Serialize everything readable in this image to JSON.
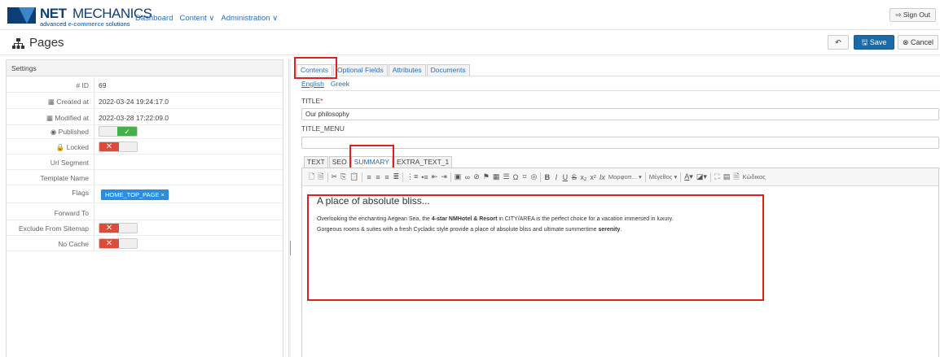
{
  "brand": {
    "name_bold": "NET",
    "name_rest": "MECHANICS",
    "tagline_pre": "advanced ",
    "tagline_bold": "e-commerce",
    "tagline_post": " solutions"
  },
  "nav": {
    "dashboard": "Dashboard",
    "content": "Content ∨",
    "administration": "Administration ∨",
    "sign_out": "⇨ Sign Out"
  },
  "header": {
    "title": "Pages",
    "back": "↶",
    "save": "🖫 Save",
    "cancel": "⊗ Cancel"
  },
  "settings": {
    "title": "Settings",
    "id_label": "# ID",
    "id_value": "69",
    "created_label": "▦ Created at",
    "created_value": "2022-03-24 19:24:17.0",
    "modified_label": "▦ Modified at",
    "modified_value": "2022-03-28 17:22:09.0",
    "published_label": "◉ Published",
    "published": true,
    "locked_label": "🔒 Locked",
    "locked": false,
    "url_segment_label": "Url Segment",
    "template_name_label": "Template Name",
    "flags_label": "Flags",
    "flag_value": "HOME_TOP_PAGE ×",
    "forward_to_label": "Forward To",
    "exclude_sitemap_label": "Exclude From Sitemap",
    "exclude_sitemap": false,
    "no_cache_label": "No Cache",
    "no_cache": false,
    "toggle_on": "✓",
    "toggle_off": "✕"
  },
  "tabs": [
    "Contents",
    "Optional Fields",
    "Attributes",
    "Documents"
  ],
  "languages": [
    "English",
    "Greek"
  ],
  "fields": {
    "title_label": "TITLE",
    "title_required": "*",
    "title_value": "Our philosophy",
    "title_menu_label": "TITLE_MENU",
    "title_menu_value": ""
  },
  "editor_tabs": [
    "TEXT",
    "SEO",
    "SUMMARY",
    "EXTRA_TEXT_1"
  ],
  "toolbar": {
    "format_combo": "Μορφοπ...  ▾",
    "size_combo": "Μέγεθος   ▾",
    "source_label": "Κώδικας"
  },
  "editor": {
    "heading": "A place of absolute bliss...",
    "p1_a": "Overlooking the enchanting Aegean Sea, the ",
    "p1_b": "4-star NMHotel & Resort",
    "p1_c": " in CITY/AREA is the perfect choice for a vacation immersed in luxury.",
    "p2_a": "Gorgeous rooms & suites with a fresh Cycladic style provide a place of absolute bliss and ultimate summertime ",
    "p2_b": "serenity",
    "p2_c": "."
  },
  "colors": {
    "primary": "#1a6aa8",
    "link": "#2a6ebb",
    "highlight": "#e02020",
    "toggle_on": "#43b049",
    "toggle_off": "#dd4b39",
    "flag": "#2a8de0"
  }
}
